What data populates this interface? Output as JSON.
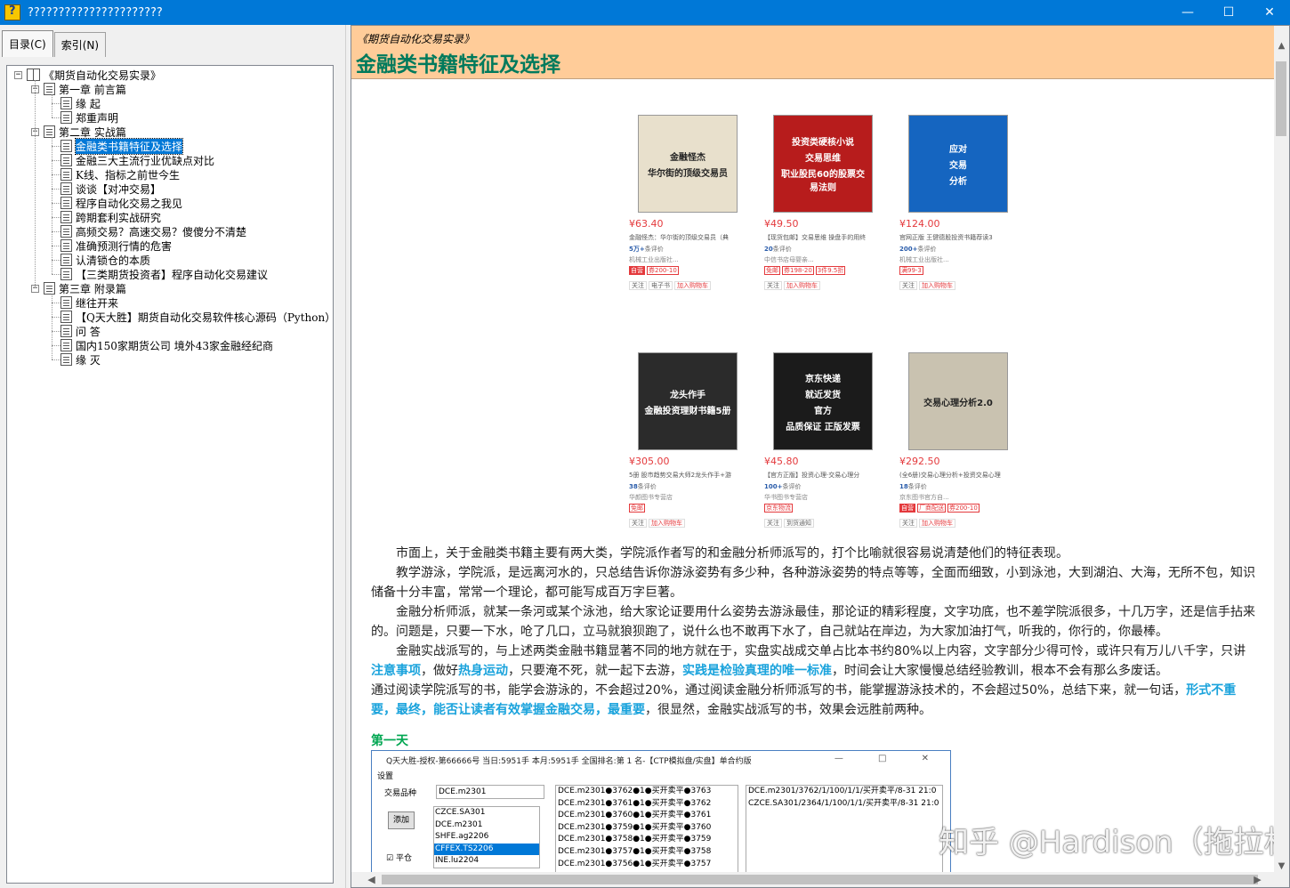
{
  "window": {
    "title": "??????????????????????"
  },
  "tabs": [
    {
      "label": "目录(C)"
    },
    {
      "label": "索引(N)"
    }
  ],
  "tree": {
    "root": "《期货自动化交易实录》",
    "chapters": [
      {
        "label": "第一章  前言篇",
        "items": [
          "缘  起",
          "郑重声明"
        ]
      },
      {
        "label": "第二章  实战篇",
        "items": [
          "金融类书籍特征及选择",
          "金融三大主流行业优缺点对比",
          "K线、指标之前世今生",
          "谈谈【对冲交易】",
          "程序自动化交易之我见",
          "跨期套利实战研究",
          "高频交易？高速交易？傻傻分不清楚",
          "准确预测行情的危害",
          "认清锁仓的本质",
          "【三类期货投资者】程序自动化交易建议"
        ]
      },
      {
        "label": "第三章  附录篇",
        "items": [
          "继往开来",
          "【Q天大胜】期货自动化交易软件核心源码（Python）",
          "问  答",
          "国内150家期货公司 境外43家金融经纪商",
          "缘  灭"
        ]
      }
    ]
  },
  "article": {
    "subtitle": "《期货自动化交易实录》",
    "title": "金融类书籍特征及选择",
    "paragraphs": {
      "p1": "市面上，关于金融类书籍主要有两大类，学院派作者写的和金融分析师派写的，打个比喻就很容易说清楚他们的特征表现。",
      "p2": "教学游泳，学院派，是远离河水的，只总结告诉你游泳姿势有多少种，各种游泳姿势的特点等等，全面而细致，小到泳池，大到湖泊、大海，无所不包，知识储备十分丰富，常常一个理论，都可能写成百万字巨著。",
      "p3": "金融分析师派，就某一条河或某个泳池，给大家论证要用什么姿势去游泳最佳，那论证的精彩程度，文字功底，也不差学院派很多，十几万字，还是信手拈来的。问题是，只要一下水，呛了几口，立马就狼狈跑了，说什么也不敢再下水了，自己就站在岸边，为大家加油打气，听我的，你行的，你最棒。",
      "p4a": "金融实战派写的，与上述两类金融书籍显著不同的地方就在于，实盘实战成交单占比本书约80%以上内容，文字部分少得可怜，或许只有万儿八千字，只讲",
      "p4h1": "注意事项",
      "p4b": "，做好",
      "p4h2": "热身运动",
      "p4c": "，只要淹不死，就一起下去游，",
      "p4h3": "实践是检验真理的唯一标准",
      "p4d": "，时间会让大家慢慢总结经验教训，根本不会有那么多废话。",
      "p5a": "通过阅读学院派写的书，能学会游泳的，不会超过20%，通过阅读金融分析师派写的书，能掌握游泳技术的，不会超过50%，总结下来，就一句话，",
      "p5h": "形式不重要，最终，能否让读者有效掌握金融交易，最重要",
      "p5b": "，很显然，金融实战派写的书，效果会远胜前两种。"
    },
    "day1": "第一天"
  },
  "products": [
    {
      "cover_lines": [
        "金融怪杰",
        "华尔街的顶级交易员"
      ],
      "cover_color": "#e8e0cc",
      "price": "¥63.40",
      "title": "金融怪杰：华尔街的顶级交易员（典",
      "comments_num": "5万+",
      "comments_suffix": "条评价",
      "shop": "机械工业出版社...",
      "tags": [
        "自营",
        "券200-10"
      ],
      "actions": [
        "关注",
        "电子书",
        "加入购物车"
      ]
    },
    {
      "cover_lines": [
        "投资类硬核小说",
        "交易思维",
        "职业股民60的股票交易法则"
      ],
      "cover_color": "#b71c1c",
      "price": "¥49.50",
      "title": "【现货包邮】交易思维 操盘手的用终",
      "comments_num": "20",
      "comments_suffix": "条评价",
      "shop": "中信书店母婴亲...",
      "tags": [
        "免邮",
        "券198-20",
        "3件9.5折"
      ],
      "actions": [
        "关注",
        "加入购物车"
      ]
    },
    {
      "cover_lines": [
        "应对",
        "交易",
        "分析"
      ],
      "cover_color": "#1565c0",
      "price": "¥124.00",
      "title": "官网正版 王健德股投资书籍荐读3",
      "comments_num": "200+",
      "comments_suffix": "条评价",
      "shop": "机械工业出版社...",
      "tags": [
        "满99-3"
      ],
      "actions": [
        "关注",
        "加入购物车"
      ]
    },
    {
      "cover_lines": [
        "龙头作手",
        "金融投资理财书籍5册"
      ],
      "cover_color": "#2b2b2b",
      "price": "¥305.00",
      "title": "5册 股市趋势交易大师2龙头作手+游",
      "comments_num": "38",
      "comments_suffix": "条评价",
      "shop": "华颜图书专营店",
      "tags": [
        "免邮"
      ],
      "actions": [
        "关注",
        "加入购物车"
      ]
    },
    {
      "cover_lines": [
        "京东快递",
        "就近发货",
        "官方",
        "品质保证 正版发票"
      ],
      "cover_color": "#1b1b1b",
      "price": "¥45.80",
      "title": "【官方正版】投资心理·交易心理分",
      "comments_num": "100+",
      "comments_suffix": "条评价",
      "shop": "华书图书专营店",
      "tags": [
        "京东物流"
      ],
      "actions": [
        "关注",
        "到货通知"
      ]
    },
    {
      "cover_lines": [
        "交易心理分析2.0"
      ],
      "cover_color": "#c9c2b0",
      "price": "¥292.50",
      "title": "(全6册)交易心理分析+投资交易心理",
      "comments_num": "18",
      "comments_suffix": "条评价",
      "shop": "京东图书官方自...",
      "tags": [
        "自营",
        "厂商配送",
        "券200-10"
      ],
      "actions": [
        "关注",
        "加入购物车"
      ]
    }
  ],
  "app_window": {
    "title": "Q天大胜-授权-第66666号 当日:5951手 本月:5951手 全国排名:第 1 名-【CTP模拟盘/实盘】单合约版",
    "menu": "设置",
    "symbol_label": "交易品种",
    "symbol_value": "DCE.m2301",
    "add_button": "添加",
    "close_pos_label": "平仓",
    "symbols": [
      "CZCE.SA301",
      "DCE.m2301",
      "SHFE.ag2206",
      "CFFEX.TS2206",
      "INE.lu2204"
    ],
    "selected_symbol": "CFFEX.TS2206",
    "orders": [
      "DCE.m2301●3762●1●买开卖平●3763",
      "DCE.m2301●3761●1●买开卖平●3762",
      "DCE.m2301●3760●1●买开卖平●3761",
      "DCE.m2301●3759●1●买开卖平●3760",
      "DCE.m2301●3758●1●买开卖平●3759",
      "DCE.m2301●3757●1●买开卖平●3758",
      "DCE.m2301●3756●1●买开卖平●3757"
    ],
    "positions": [
      "DCE.m2301/3762/1/100/1/1/买开卖平/8-31 21:0",
      "CZCE.SA301/2364/1/100/1/1/买开卖平/8-31 21:0"
    ]
  },
  "watermark": "知乎 @Hardison（拖拉机）",
  "colors": {
    "titlebar": "#0078d7",
    "header_bg": "#ffcc99",
    "title_green": "#007a5c",
    "highlight_blue": "#1aa3dc",
    "day_green": "#00a651",
    "price_red": "#e4393c"
  }
}
